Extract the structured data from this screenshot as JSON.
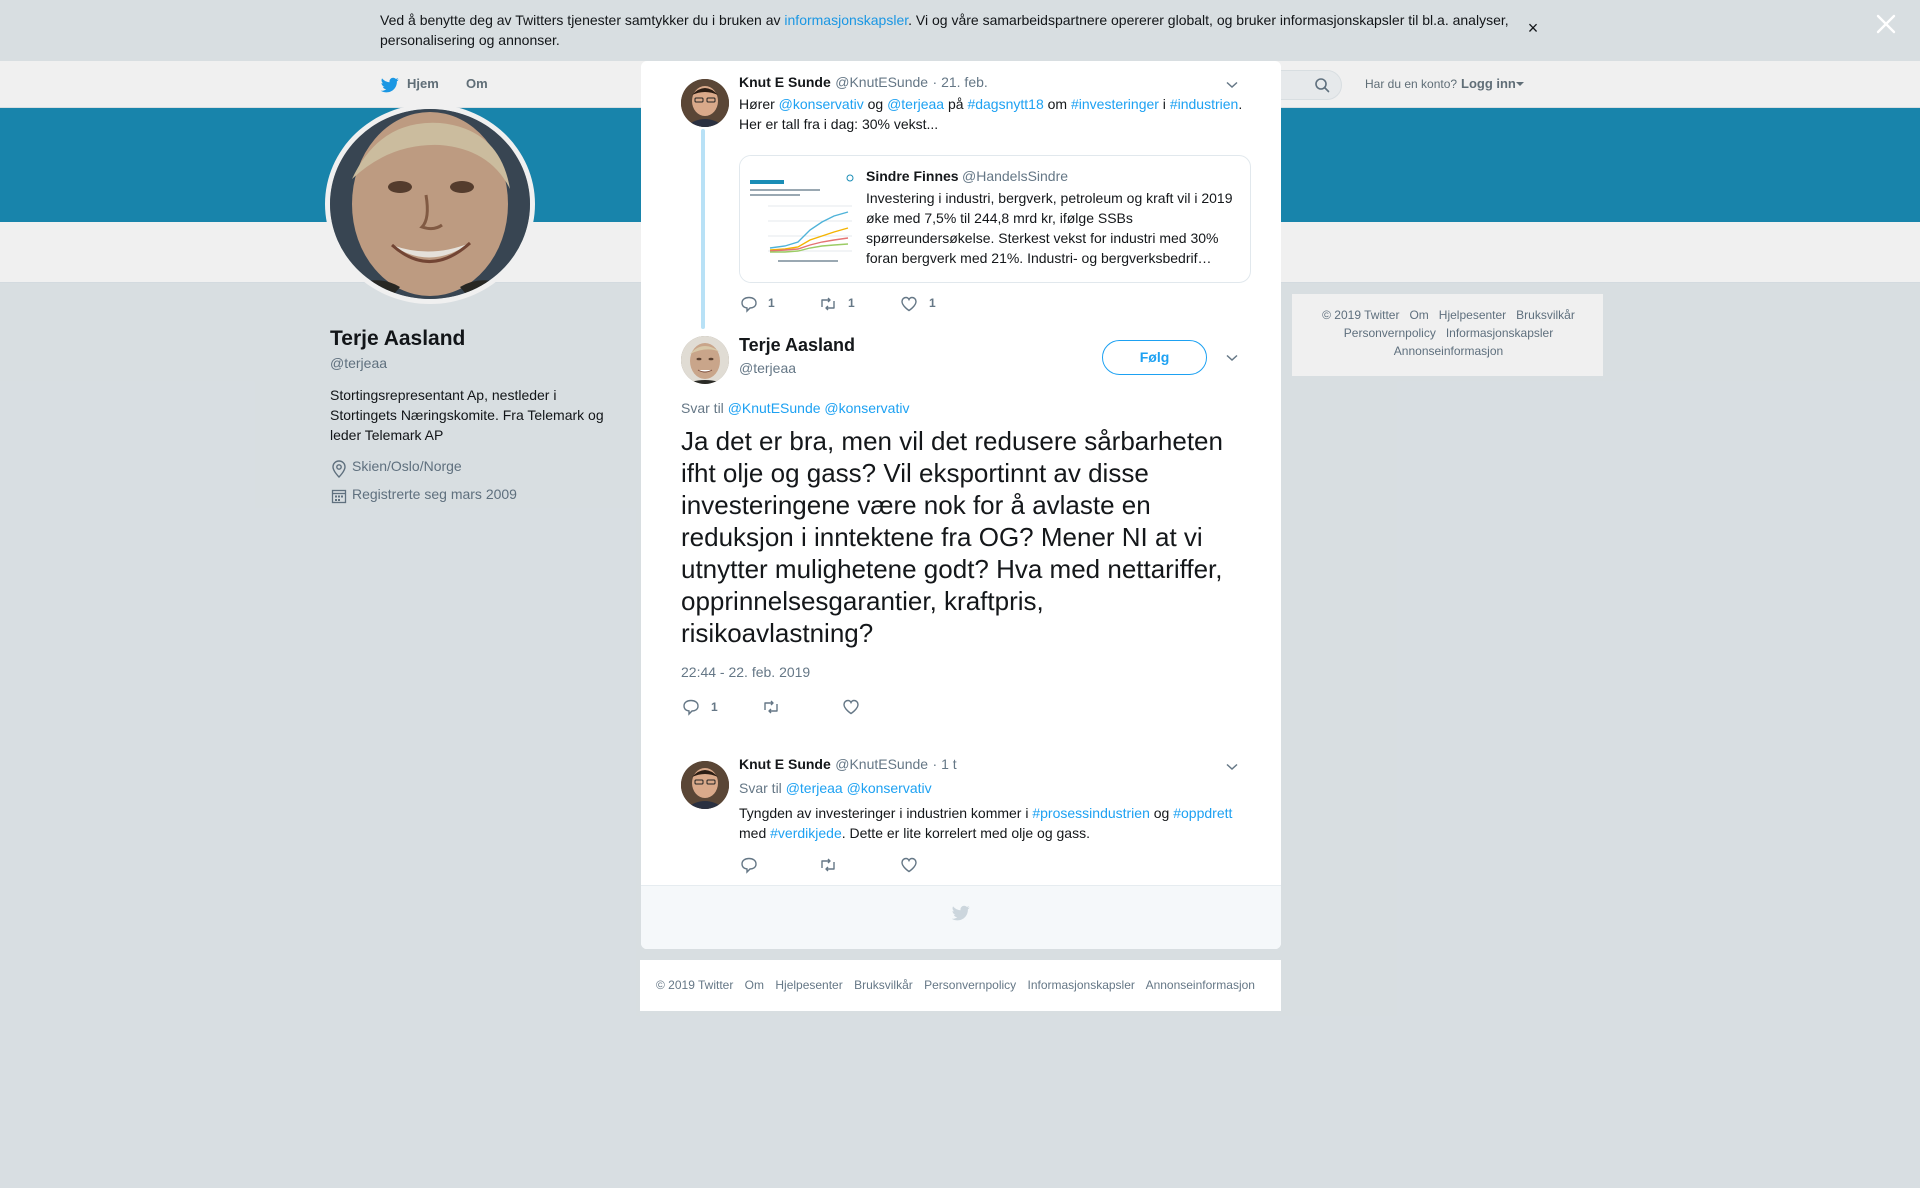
{
  "cookie_banner": {
    "text_before": "Ved å benytte deg av Twitters tjenester samtykker du i bruken av ",
    "link": "informasjonskapsler",
    "text_after": ". Vi og våre samarbeidspartnere opererer globalt, og bruker informasjonskapsler til bl.a. analyser, personalisering og annonser.",
    "close": "×"
  },
  "nav": {
    "home": "Hjem",
    "about": "Om",
    "login_prompt": "Har du en konto?",
    "login": "Logg inn"
  },
  "profile": {
    "name": "Terje Aasland",
    "handle": "@terjeaa",
    "bio": "Stortingsrepresentant Ap, nestleder i Stortingets Næringskomite. Fra Telemark og leder Telemark AP",
    "location": "Skien/Oslo/Norge",
    "joined": "Registrerte seg mars 2009"
  },
  "side_footer": {
    "line1": [
      "© 2019 Twitter",
      "Om",
      "Hjelpesenter",
      "Bruksvilkår"
    ],
    "line2": [
      "Personvernpolicy",
      "Informasjonskapsler"
    ],
    "line3": [
      "Annonseinformasjon"
    ]
  },
  "thread": {
    "parent": {
      "name": "Knut E Sunde",
      "handle": "@KnutESunde",
      "date": "· 21. feb.",
      "text": {
        "w1": "Hører ",
        "m1": "@konservativ",
        "w2": " og ",
        "m2": "@terjeaa",
        "w3": " på ",
        "h1": "#dagsnytt18",
        "w4": " om ",
        "h2": "#investeringer",
        "w5": " i ",
        "h3": "#industrien",
        "w6": ". Her er tall fra i dag: 30% vekst..."
      },
      "quote": {
        "name": "Sindre Finnes",
        "handle": "@HandelsSindre",
        "text": "Investering i industri, bergverk, petroleum og kraft vil i 2019 øke med 7,5% til 244,8 mrd kr, ifølge SSBs spørreundersøkelse. Sterkest vekst for industri med 30% foran bergverk med 21%. Industri- og bergverksbedrif…"
      },
      "reply_count": "1",
      "retweet_count": "1",
      "like_count": "1"
    },
    "main": {
      "name": "Terje Aasland",
      "handle": "@terjeaa",
      "follow": "Følg",
      "reply_to_label": "Svar til ",
      "reply_to_1": "@KnutESunde",
      "reply_to_2": "@konservativ",
      "text": "Ja det er bra, men vil det redusere sårbarheten ifht olje og gass? Vil eksportinnt av disse investeringene være nok for å avlaste en reduksjon i inntektene fra OG? Mener NI at vi utnytter mulighetene godt? Hva med nettariffer, opprinnelsesgarantier, kraftpris, risikoavlastning?",
      "time": "22:44 - 22. feb. 2019",
      "reply_count": "1"
    },
    "reply": {
      "name": "Knut E Sunde",
      "handle": "@KnutESunde",
      "date": "· 1 t",
      "reply_to_label": "Svar til ",
      "reply_to_1": "@terjeaa",
      "reply_to_2": "@konservativ",
      "text": {
        "w1": "Tyngden av investeringer i industrien kommer i ",
        "h1": "#prosessindustrien",
        "w2": " og ",
        "h2": "#oppdrett",
        "w3": " med ",
        "h3": "#verdikjede",
        "w4": ". Dette er lite korrelert med olje og gass."
      }
    }
  },
  "bottom_footer": [
    "© 2019 Twitter",
    "Om",
    "Hjelpesenter",
    "Bruksvilkår",
    "Personvernpolicy",
    "Informasjonskapsler",
    "Annonseinformasjon"
  ],
  "colors": {
    "accent": "#1da1f2",
    "banner": "#1a8db6",
    "background": "#e6ecf0"
  }
}
